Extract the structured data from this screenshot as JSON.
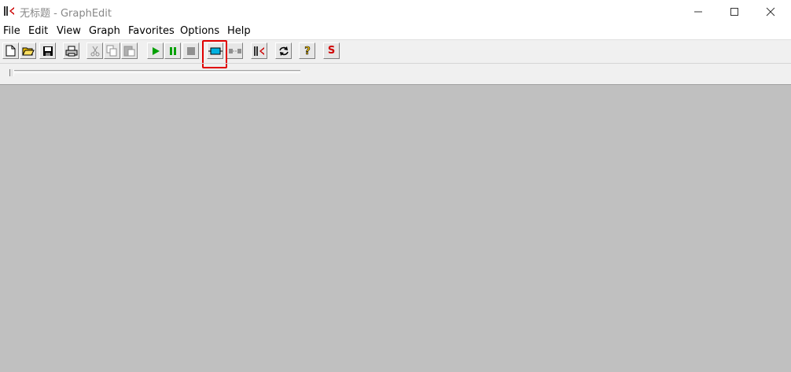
{
  "window": {
    "title": "无标题 - GraphEdit"
  },
  "menubar": {
    "items": [
      "File",
      "Edit",
      "View",
      "Graph",
      "Favorites",
      "Options",
      "Help"
    ]
  },
  "toolbar": {
    "buttons": [
      {
        "icon": "new-file-icon"
      },
      {
        "icon": "open-folder-icon"
      },
      {
        "icon": "save-icon"
      },
      {
        "icon": "print-icon"
      },
      {
        "icon": "cut-icon"
      },
      {
        "icon": "copy-icon"
      },
      {
        "icon": "paste-icon"
      },
      {
        "icon": "play-icon"
      },
      {
        "icon": "pause-icon"
      },
      {
        "icon": "stop-icon"
      },
      {
        "icon": "insert-filter-icon"
      },
      {
        "icon": "disconnect-filter-icon"
      },
      {
        "icon": "graphedit-icon"
      },
      {
        "icon": "refresh-icon"
      },
      {
        "icon": "help-icon"
      },
      {
        "icon": "sync-icon",
        "label": "S"
      }
    ],
    "highlighted": "insert-filter-icon",
    "highlight_color": "#e00000"
  },
  "colors": {
    "workspace": "#c0c0c0",
    "toolbar_bg": "#f0f0f0",
    "play_green": "#00a000",
    "filter_cyan": "#00b0e0",
    "sync_red": "#d00000"
  }
}
